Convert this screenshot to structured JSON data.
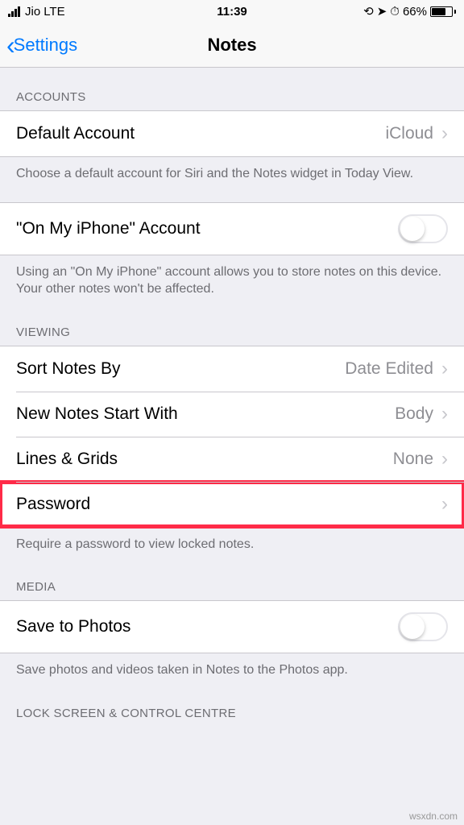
{
  "status": {
    "carrier": "Jio",
    "network": "LTE",
    "time": "11:39",
    "battery_pct": "66%",
    "orientation_lock": "⊕",
    "location": "➤",
    "alarm": "⏰"
  },
  "nav": {
    "back": "Settings",
    "title": "Notes"
  },
  "sections": {
    "accounts": {
      "header": "ACCOUNTS",
      "default_account_label": "Default Account",
      "default_account_value": "iCloud",
      "default_footer": "Choose a default account for Siri and the Notes widget in Today View.",
      "on_my_iphone_label": "\"On My iPhone\" Account",
      "on_my_iphone_footer": "Using an \"On My iPhone\" account allows you to store notes on this device. Your other notes won't be affected."
    },
    "viewing": {
      "header": "VIEWING",
      "sort_label": "Sort Notes By",
      "sort_value": "Date Edited",
      "newnotes_label": "New Notes Start With",
      "newnotes_value": "Body",
      "lines_label": "Lines & Grids",
      "lines_value": "None",
      "password_label": "Password",
      "password_footer": "Require a password to view locked notes."
    },
    "media": {
      "header": "MEDIA",
      "save_label": "Save to Photos",
      "save_footer": "Save photos and videos taken in Notes to the Photos app."
    },
    "lockcc": {
      "header": "LOCK SCREEN & CONTROL CENTRE"
    }
  },
  "watermark": "wsxdn.com"
}
